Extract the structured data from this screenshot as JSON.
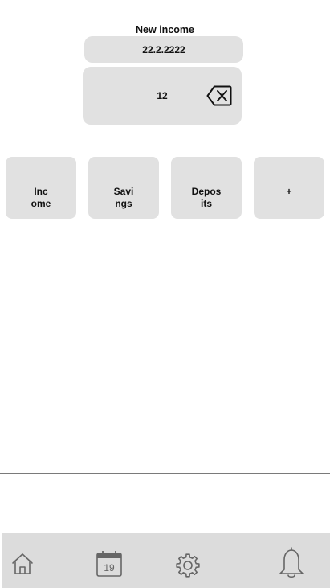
{
  "header": {
    "title": "New income"
  },
  "form": {
    "date": "22.2.2222",
    "amount": "12",
    "backspace_icon": "backspace-icon"
  },
  "categories": [
    {
      "label": "Inc\nome"
    },
    {
      "label": "Savi\nngs"
    },
    {
      "label": "Depos\nits"
    },
    {
      "label": "+"
    }
  ],
  "navbar": {
    "calendar_day": "19",
    "icons": [
      "home-icon",
      "calendar-icon",
      "settings-icon",
      "bell-icon"
    ]
  },
  "colors": {
    "field_bg": "#e1e1e1",
    "navbar_bg": "#dcdcdc",
    "icon_stroke": "#666666"
  }
}
